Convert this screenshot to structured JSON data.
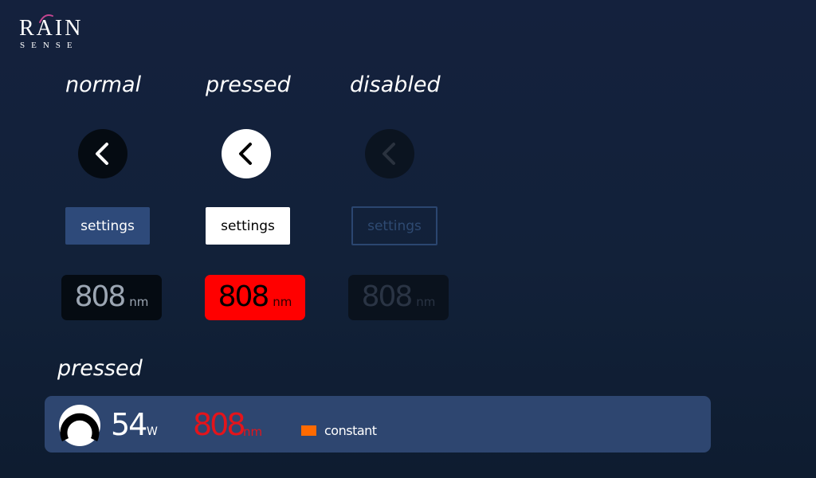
{
  "logo": {
    "main": "RAIN",
    "sub": "SENSE",
    "accent_color": "#c2458f"
  },
  "headings": {
    "normal": "normal",
    "pressed": "pressed",
    "disabled": "disabled",
    "status_pressed": "pressed"
  },
  "back_buttons": {
    "icon": "chevron-left-icon",
    "normal_bg": "#050b12",
    "pressed_bg": "#ffffff",
    "disabled_bg": "#0b1420"
  },
  "settings_buttons": {
    "normal": "settings",
    "pressed": "settings",
    "disabled": "settings"
  },
  "wavelength_buttons": {
    "normal": {
      "value": "808",
      "unit": "nm"
    },
    "pressed": {
      "value": "808",
      "unit": "nm"
    },
    "disabled": {
      "value": "808",
      "unit": "nm"
    }
  },
  "status_bar": {
    "gauge_icon": "power-gauge-icon",
    "power_value": "54",
    "power_unit": "W",
    "wavelength_value": "808",
    "wavelength_unit": "nm",
    "mode_label": "constant",
    "mode_color": "#ff6a00",
    "background": "#2e4670"
  }
}
